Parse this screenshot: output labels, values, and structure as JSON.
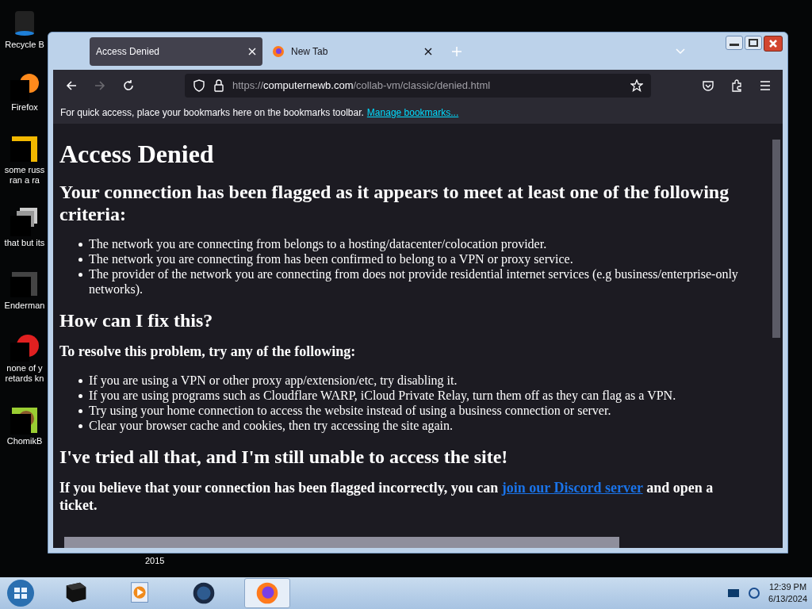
{
  "desktop": {
    "icons": [
      {
        "kind": "bin",
        "lines": [
          "Recycle B"
        ]
      },
      {
        "kind": "firefox",
        "lines": [
          "Firefox"
        ]
      },
      {
        "kind": "yellow",
        "lines": [
          "some russ",
          "ran a ra"
        ]
      },
      {
        "kind": "stack",
        "lines": [
          "that but its"
        ]
      },
      {
        "kind": "window",
        "lines": [
          "Enderman"
        ]
      },
      {
        "kind": "red",
        "lines": [
          "none of y",
          "retards kn"
        ]
      },
      {
        "kind": "bear",
        "lines": [
          "ChomikB"
        ]
      }
    ],
    "hidden_label": "2015"
  },
  "browser": {
    "tabs": [
      {
        "title": "Access Denied",
        "selected": true,
        "favicon": false
      },
      {
        "title": "New Tab",
        "selected": false,
        "favicon": true
      }
    ],
    "nav": [
      {
        "kind": "back",
        "disabled": false
      },
      {
        "kind": "forward",
        "disabled": true
      },
      {
        "kind": "reload",
        "disabled": false
      }
    ],
    "url": {
      "scheme": "https://",
      "host": "computernewb.com",
      "path": "/collab-vm/classic/denied.html"
    },
    "bookmarks_bar": {
      "text": "For quick access, place your bookmarks here on the bookmarks toolbar.",
      "link": "Manage bookmarks..."
    },
    "page": [
      {
        "kind": "h1",
        "text": "Access Denied"
      },
      {
        "kind": "h2",
        "text": "Your connection has been flagged as it appears to meet at least one of the following criteria:"
      },
      {
        "kind": "list",
        "items": [
          "The network you are connecting from belongs to a hosting/datacenter/colocation provider.",
          "The network you are connecting from has been confirmed to belong to a VPN or proxy service.",
          "The provider of the network you are connecting from does not provide residential internet services (e.g business/enterprise-only networks)."
        ]
      },
      {
        "kind": "h2",
        "text": "How can I fix this?"
      },
      {
        "kind": "h3",
        "text": "To resolve this problem, try any of the following:"
      },
      {
        "kind": "list",
        "items": [
          "If you are using a VPN or other proxy app/extension/etc, try disabling it.",
          "If you are using programs such as Cloudflare WARP, iCloud Private Relay, turn them off as they can flag as a VPN.",
          "Try using your home connection to access the website instead of using a business connection or server.",
          "Clear your browser cache and cookies, then try accessing the site again."
        ]
      },
      {
        "kind": "h2",
        "text": "I've tried all that, and I'm still unable to access the site!"
      },
      {
        "kind": "linkpara",
        "before": "If you believe that your connection has been flagged incorrectly, you can",
        "link": "join our Discord server",
        "after": "and open a ticket."
      }
    ]
  },
  "taskbar": {
    "items": [
      {
        "kind": "box",
        "selected": false
      },
      {
        "kind": "player",
        "selected": false
      },
      {
        "kind": "globe",
        "selected": false
      },
      {
        "kind": "firefox",
        "selected": true
      }
    ],
    "clock": {
      "time": "12:39 PM",
      "date": "6/13/2024"
    }
  }
}
